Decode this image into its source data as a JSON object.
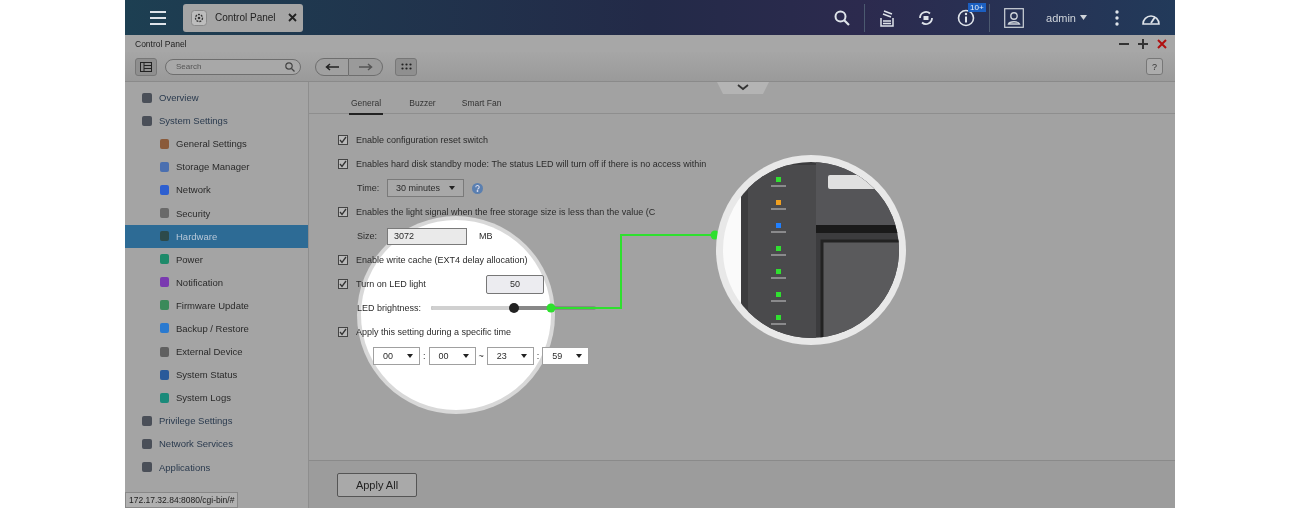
{
  "top_bar": {
    "app_tab": {
      "label": "Control Panel"
    },
    "notification_badge": "10+",
    "user": "admin"
  },
  "window": {
    "title": "Control Panel",
    "help_button": "?"
  },
  "toolbar": {
    "search": {
      "placeholder": "Search"
    }
  },
  "sidebar": {
    "items": [
      {
        "label": "Overview",
        "selected": false
      },
      {
        "label": "System Settings",
        "selected": false,
        "children": [
          {
            "label": "General Settings",
            "selected": false
          },
          {
            "label": "Storage Manager",
            "selected": false
          },
          {
            "label": "Network",
            "selected": false
          },
          {
            "label": "Security",
            "selected": false
          },
          {
            "label": "Hardware",
            "selected": true
          },
          {
            "label": "Power",
            "selected": false
          },
          {
            "label": "Notification",
            "selected": false
          },
          {
            "label": "Firmware Update",
            "selected": false
          },
          {
            "label": "Backup / Restore",
            "selected": false
          },
          {
            "label": "External Device",
            "selected": false
          },
          {
            "label": "System Status",
            "selected": false
          },
          {
            "label": "System Logs",
            "selected": false
          }
        ]
      },
      {
        "label": "Privilege Settings",
        "selected": false
      },
      {
        "label": "Network Services",
        "selected": false
      },
      {
        "label": "Applications",
        "selected": false
      }
    ]
  },
  "tabs": [
    {
      "label": "General",
      "selected": true
    },
    {
      "label": "Buzzer",
      "selected": false
    },
    {
      "label": "Smart Fan",
      "selected": false
    }
  ],
  "settings": [
    {
      "kind": "checkbox",
      "label": "Enable configuration reset switch",
      "checked": true
    },
    {
      "kind": "checkbox",
      "label": "Enables hard disk standby mode: The status LED will turn off if there is no access within",
      "checked": true
    },
    {
      "kind": "select",
      "label": "Time:",
      "value": "30 minutes"
    },
    {
      "kind": "checkbox",
      "label": "Enables the light signal when the free storage size is less than the value (C",
      "checked": true
    },
    {
      "kind": "input",
      "label": "Size:",
      "value": "3072",
      "unit": "MB"
    },
    {
      "kind": "checkbox",
      "label": "Enable write cache (EXT4 delay allocation)",
      "checked": true
    },
    {
      "kind": "checkbox",
      "label": "Turn on LED light",
      "checked": true,
      "value": "50"
    },
    {
      "kind": "slider",
      "label": "LED brightness:",
      "level": 0.5
    },
    {
      "kind": "checkbox",
      "label": "Apply this setting during a specific time",
      "checked": true
    },
    {
      "kind": "time_range",
      "fields": [
        "00",
        "00",
        "23",
        "59"
      ],
      "separators": [
        ":",
        "~",
        ":"
      ]
    }
  ],
  "apply_button": "Apply All",
  "status_url": "172.17.32.84:8080/cgi-bin/#"
}
